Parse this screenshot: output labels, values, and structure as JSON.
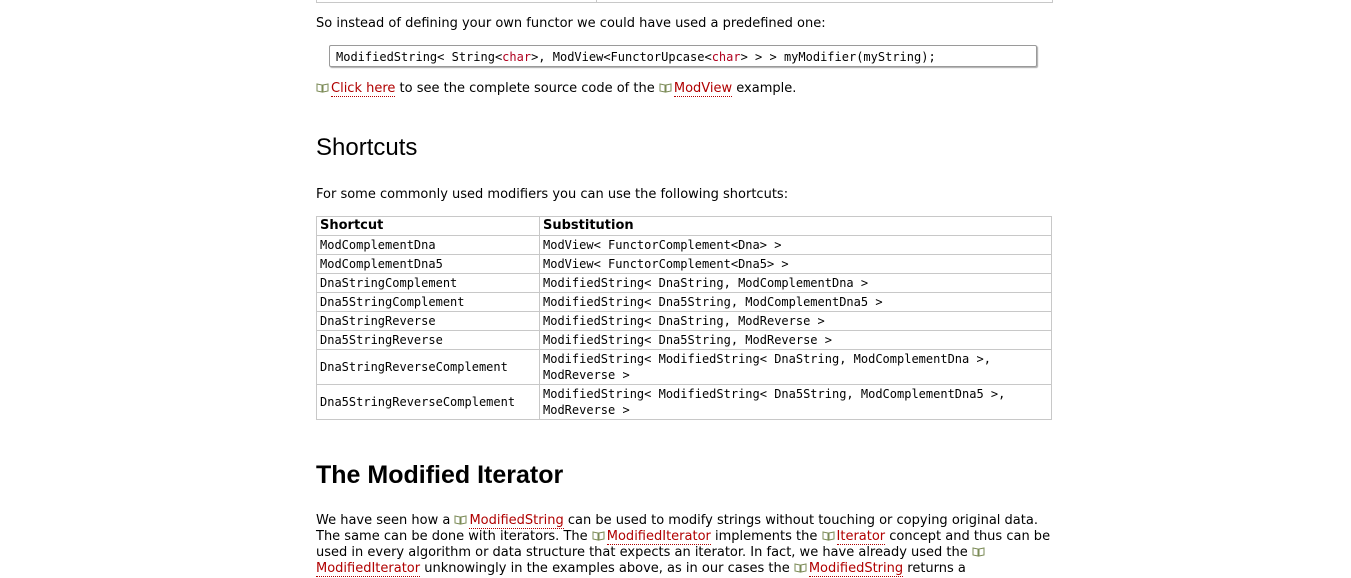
{
  "intro": "So instead of defining your own functor we could have used a predefined one:",
  "code": {
    "p1": "ModifiedString< String<",
    "kw1": "char",
    "p2": ">, ModView<FunctorUpcase<",
    "kw2": "char",
    "p3": "> > > myModifier(myString);"
  },
  "link_line": {
    "click_here": "Click here",
    "middle": " to see the complete source code of the ",
    "modview": "ModView",
    "tail": " example."
  },
  "shortcuts": {
    "heading": "Shortcuts",
    "intro": "For some commonly used modifiers you can use the following shortcuts:",
    "table": {
      "headers": [
        "Shortcut",
        "Substitution"
      ],
      "rows": [
        [
          "ModComplementDna",
          "ModView< FunctorComplement<Dna> >"
        ],
        [
          "ModComplementDna5",
          "ModView< FunctorComplement<Dna5> >"
        ],
        [
          "DnaStringComplement",
          "ModifiedString< DnaString, ModComplementDna >"
        ],
        [
          "Dna5StringComplement",
          "ModifiedString< Dna5String, ModComplementDna5 >"
        ],
        [
          "DnaStringReverse",
          "ModifiedString< DnaString, ModReverse >"
        ],
        [
          "Dna5StringReverse",
          "ModifiedString< Dna5String, ModReverse >"
        ],
        [
          "DnaStringReverseComplement",
          "ModifiedString< ModifiedString< DnaString, ModComplementDna >, ModReverse >"
        ],
        [
          "Dna5StringReverseComplement",
          "ModifiedString< ModifiedString< Dna5String, ModComplementDna5 >, ModReverse >"
        ]
      ]
    }
  },
  "modified_iterator": {
    "heading": "The Modified Iterator",
    "t1": "We have seen how a ",
    "l1": "ModifiedString",
    "t2": " can be used to modify strings without touching or copying original data. The same can be done with iterators. The ",
    "l2": "ModifiedIterator",
    "t3": " implements the ",
    "l3": "Iterator",
    "t4": " concept and thus can be used in every algorithm or data structure that expects an iterator. In fact, we have already used the ",
    "l4": "ModifiedIterator",
    "t5": " unknowingly in the examples above, as in our cases the ",
    "l5": "ModifiedString",
    "t6": " returns a"
  },
  "colors": {
    "link": "#b00000",
    "keyword": "#b0001e",
    "border": "#c8c8c8"
  },
  "icons": {
    "link_prefix": "book-icon"
  }
}
